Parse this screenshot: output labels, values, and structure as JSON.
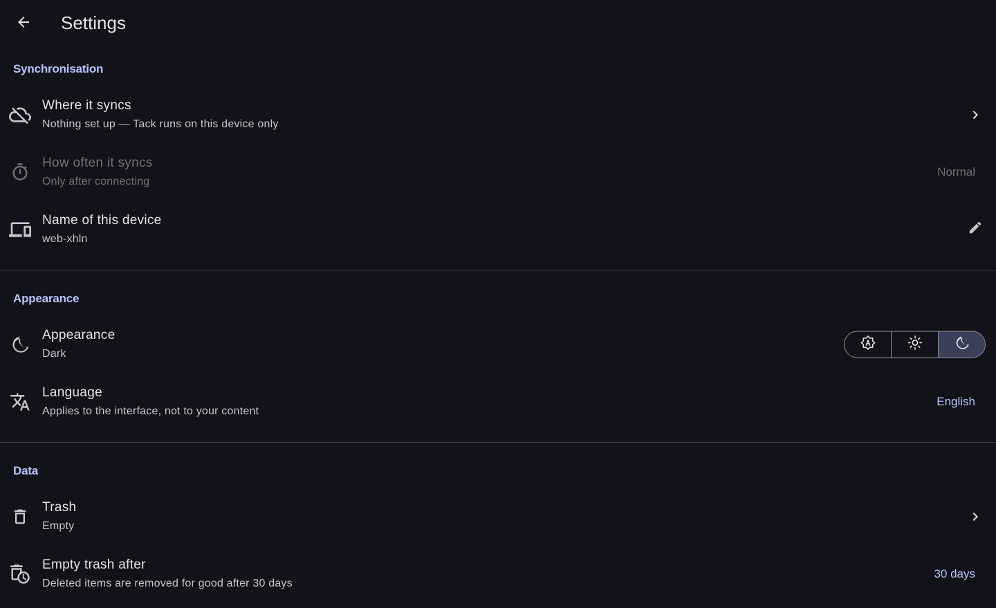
{
  "header": {
    "title": "Settings",
    "back_icon": "arrow-left-icon"
  },
  "colors": {
    "background": "#121318",
    "accent": "#b4c4ff",
    "text_primary": "#e3e2e9",
    "text_secondary": "#c6c5d0",
    "text_disabled": "#6f6f77",
    "divider": "#3a3b42"
  },
  "sections": {
    "sync": {
      "header": "Synchronisation",
      "where": {
        "title": "Where it syncs",
        "subtitle": "Nothing set up — Tack runs on this device only",
        "icon": "cloud-off-icon"
      },
      "how_often": {
        "title": "How often it syncs",
        "subtitle": "Only after connecting",
        "value": "Normal",
        "icon": "timer-icon",
        "disabled": true
      },
      "device_name": {
        "title": "Name of this device",
        "subtitle": "web-xhln",
        "icon": "devices-icon"
      }
    },
    "appearance": {
      "header": "Appearance",
      "theme": {
        "title": "Appearance",
        "subtitle": "Dark",
        "icon": "moon-icon",
        "options": [
          "auto",
          "light",
          "dark"
        ],
        "selected": "dark"
      },
      "language": {
        "title": "Language",
        "subtitle": "Applies to the interface, not to your content",
        "value": "English",
        "icon": "translate-icon"
      }
    },
    "data": {
      "header": "Data",
      "trash": {
        "title": "Trash",
        "subtitle": "Empty",
        "icon": "trash-icon"
      },
      "empty_after": {
        "title": "Empty trash after",
        "subtitle": "Deleted items are removed for good after 30 days",
        "value": "30 days",
        "icon": "auto-delete-icon"
      }
    }
  }
}
